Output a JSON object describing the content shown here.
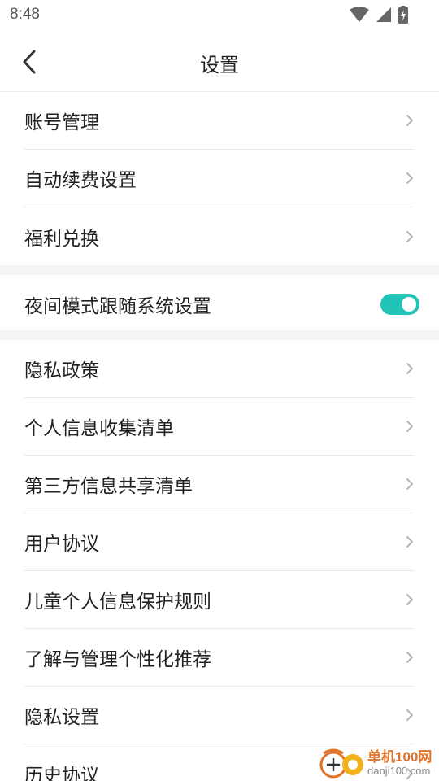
{
  "status_bar": {
    "time": "8:48",
    "icons": [
      "wifi-icon",
      "cellular-signal-icon",
      "battery-charging-icon"
    ]
  },
  "header": {
    "title": "设置",
    "back_icon": "chevron-left-icon"
  },
  "groups": [
    {
      "items": [
        {
          "label": "账号管理",
          "type": "link"
        },
        {
          "label": "自动续费设置",
          "type": "link"
        },
        {
          "label": "福利兑换",
          "type": "link"
        }
      ]
    },
    {
      "items": [
        {
          "label": "夜间模式跟随系统设置",
          "type": "toggle",
          "on": true
        }
      ]
    },
    {
      "items": [
        {
          "label": "隐私政策",
          "type": "link"
        },
        {
          "label": "个人信息收集清单",
          "type": "link"
        },
        {
          "label": "第三方信息共享清单",
          "type": "link"
        },
        {
          "label": "用户协议",
          "type": "link"
        },
        {
          "label": "儿童个人信息保护规则",
          "type": "link"
        },
        {
          "label": "了解与管理个性化推荐",
          "type": "link"
        },
        {
          "label": "隐私设置",
          "type": "link"
        },
        {
          "label": "历史协议",
          "type": "link"
        }
      ]
    }
  ],
  "colors": {
    "accent": "#21c5b8",
    "divider": "#e9e9e9",
    "section_gap": "#f4f4f4",
    "chevron": "#b5b5b5"
  },
  "watermark": {
    "title": "单机100网",
    "url": "danji100.com"
  }
}
